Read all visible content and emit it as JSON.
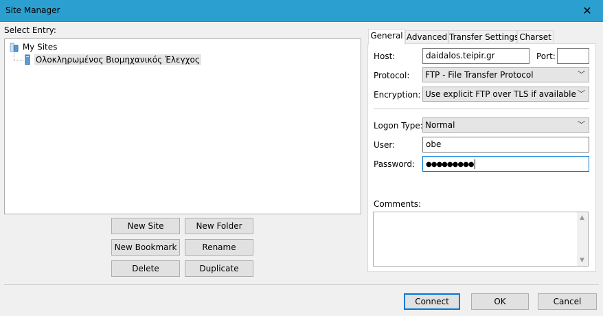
{
  "window": {
    "title": "Site Manager",
    "close_glyph": "✕"
  },
  "left": {
    "select_entry_label": "Select Entry:",
    "tree": {
      "root": "My Sites",
      "items": [
        {
          "label": "Ολοκληρωμένος Βιομηχανικός Έλεγχος",
          "selected": true
        }
      ]
    },
    "buttons": {
      "new_site": "New Site",
      "new_folder": "New Folder",
      "new_bookmark": "New Bookmark",
      "rename": "Rename",
      "delete": "Delete",
      "duplicate": "Duplicate"
    }
  },
  "tabs": [
    "General",
    "Advanced",
    "Transfer Settings",
    "Charset"
  ],
  "active_tab": "General",
  "general": {
    "host_label": "Host:",
    "host_value": "daidalos.teipir.gr",
    "port_label": "Port:",
    "port_value": "",
    "protocol_label": "Protocol:",
    "protocol_value": "FTP - File Transfer Protocol",
    "encryption_label": "Encryption:",
    "encryption_value": "Use explicit FTP over TLS if available",
    "logon_type_label": "Logon Type:",
    "logon_type_value": "Normal",
    "user_label": "User:",
    "user_value": "obe",
    "password_label": "Password:",
    "password_value": "●●●●●●●●●",
    "comments_label": "Comments:",
    "comments_value": ""
  },
  "footer": {
    "connect": "Connect",
    "ok": "OK",
    "cancel": "Cancel"
  },
  "colors": {
    "titlebar": "#2b9fd0",
    "focus": "#0078d7",
    "button": "#e1e1e1"
  }
}
